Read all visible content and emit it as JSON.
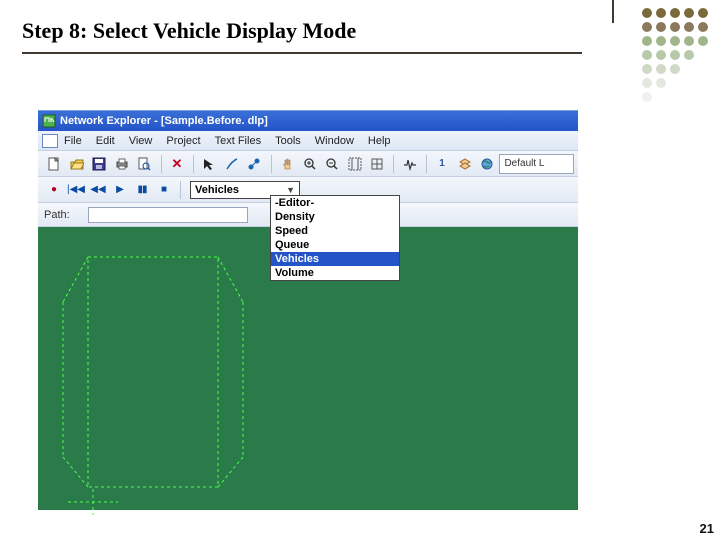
{
  "slide": {
    "title": "Step 8: Select Vehicle Display Mode",
    "page_number": "21"
  },
  "dotgrid": {
    "rows": [
      [
        "#7a6a3a",
        "#7a6a3a",
        "#7a6a3a",
        "#7a6a3a",
        "#7a6a3a"
      ],
      [
        "#8a795c",
        "#8a795c",
        "#8a795c",
        "#8a795c",
        "#8a795c"
      ],
      [
        "#9fb68a",
        "#9fb68a",
        "#9fb68a",
        "#9fb68a",
        "#9fb68a"
      ],
      [
        "#b7c9a8",
        "#b7c9a8",
        "#b7c9a8",
        "#b7c9a8",
        ""
      ],
      [
        "#cfd9c5",
        "#cfd9c5",
        "#cfd9c5",
        "",
        ""
      ],
      [
        "#e2e8de",
        "#e2e8de",
        "",
        "",
        ""
      ],
      [
        "#eef1ec",
        "",
        "",
        "",
        ""
      ]
    ]
  },
  "app": {
    "title": "Network Explorer - [Sample.Before. dlp]",
    "menus": [
      "File",
      "Edit",
      "View",
      "Project",
      "Text Files",
      "Tools",
      "Window",
      "Help"
    ],
    "mode_label": "Default L",
    "path_label": "Path:",
    "display_mode": {
      "selected": "Vehicles",
      "options": [
        "-Editor-",
        "Density",
        "Speed",
        "Queue",
        "Vehicles",
        "Volume"
      ]
    }
  }
}
